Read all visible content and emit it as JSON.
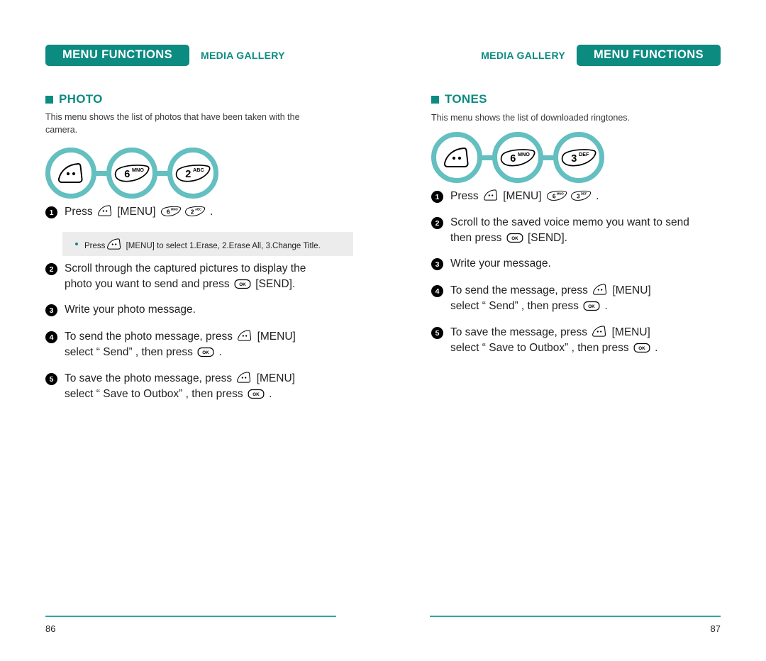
{
  "document": {
    "type": "mobile-phone-user-manual-spread"
  },
  "colors": {
    "teal_dark": "#0c8b81",
    "teal_light": "#63bfc0",
    "rule": "#2fa5ac",
    "note_bg": "#ececec",
    "text": "#231f20"
  },
  "left_page": {
    "header": {
      "tab_label": "MENU FUNCTIONS",
      "breadcrumb": "MEDIA GALLERY"
    },
    "section": {
      "title": "PHOTO",
      "intro": "This menu shows the list of photos that have been taken with the camera."
    },
    "keychain": [
      {
        "icon": "menu-key-icon",
        "label": "",
        "sub": ""
      },
      {
        "icon": "digit-key-icon",
        "label": "6",
        "sub": "MNO"
      },
      {
        "icon": "digit-key-icon",
        "label": "2",
        "sub": "ABC"
      }
    ],
    "steps": [
      {
        "num": "1",
        "lines": [
          [
            {
              "t": "text",
              "v": "Press "
            },
            {
              "t": "key-menu"
            },
            {
              "t": "text",
              "v": " [MENU] "
            },
            {
              "t": "key-digit",
              "v": "6",
              "sub": "MNO"
            },
            {
              "t": "key-digit",
              "v": "2",
              "sub": "ABC"
            },
            {
              "t": "text",
              "v": " ."
            }
          ]
        ]
      },
      {
        "num": "2",
        "lines": [
          [
            {
              "t": "text",
              "v": "Scroll through the captured pictures to display the"
            }
          ],
          [
            {
              "t": "text",
              "v": "photo you want to send and press "
            },
            {
              "t": "key-ok"
            },
            {
              "t": "text",
              "v": " [SEND]."
            }
          ]
        ]
      },
      {
        "num": "3",
        "lines": [
          [
            {
              "t": "text",
              "v": "Write your photo message."
            }
          ]
        ]
      },
      {
        "num": "4",
        "lines": [
          [
            {
              "t": "text",
              "v": "To send the photo message, press "
            },
            {
              "t": "key-menu"
            },
            {
              "t": "text",
              "v": " [MENU]"
            }
          ],
          [
            {
              "t": "text",
              "v": "select “ Send” , then press "
            },
            {
              "t": "key-ok"
            },
            {
              "t": "text",
              "v": " ."
            }
          ]
        ]
      },
      {
        "num": "5",
        "lines": [
          [
            {
              "t": "text",
              "v": "To save the photo message, press "
            },
            {
              "t": "key-menu"
            },
            {
              "t": "text",
              "v": " [MENU]"
            }
          ],
          [
            {
              "t": "text",
              "v": "select “ Save to Outbox” , then press "
            },
            {
              "t": "key-ok"
            },
            {
              "t": "text",
              "v": " ."
            }
          ]
        ]
      }
    ],
    "note": {
      "parts": [
        {
          "t": "text",
          "v": "Press"
        },
        {
          "t": "key-menu"
        },
        {
          "t": "text",
          "v": " [MENU] to select 1.Erase, 2.Erase All, 3.Change Title."
        }
      ]
    },
    "page_number": "86"
  },
  "right_page": {
    "header": {
      "tab_label": "MENU FUNCTIONS",
      "breadcrumb": "MEDIA GALLERY"
    },
    "section": {
      "title": "TONES",
      "intro": "This menu shows the list of downloaded ringtones."
    },
    "keychain": [
      {
        "icon": "menu-key-icon",
        "label": "",
        "sub": ""
      },
      {
        "icon": "digit-key-icon",
        "label": "6",
        "sub": "MNO"
      },
      {
        "icon": "digit-key-icon",
        "label": "3",
        "sub": "DEF"
      }
    ],
    "steps": [
      {
        "num": "1",
        "lines": [
          [
            {
              "t": "text",
              "v": "Press "
            },
            {
              "t": "key-menu"
            },
            {
              "t": "text",
              "v": " [MENU] "
            },
            {
              "t": "key-digit",
              "v": "6",
              "sub": "MNO"
            },
            {
              "t": "key-digit",
              "v": "3",
              "sub": "DEF"
            },
            {
              "t": "text",
              "v": " ."
            }
          ]
        ]
      },
      {
        "num": "2",
        "lines": [
          [
            {
              "t": "text",
              "v": "Scroll to the saved voice memo you want to send"
            }
          ],
          [
            {
              "t": "text",
              "v": "then press "
            },
            {
              "t": "key-ok"
            },
            {
              "t": "text",
              "v": " [SEND]."
            }
          ]
        ]
      },
      {
        "num": "3",
        "lines": [
          [
            {
              "t": "text",
              "v": "Write your message."
            }
          ]
        ]
      },
      {
        "num": "4",
        "lines": [
          [
            {
              "t": "text",
              "v": "To send the message, press "
            },
            {
              "t": "key-menu"
            },
            {
              "t": "text",
              "v": " [MENU]"
            }
          ],
          [
            {
              "t": "text",
              "v": "select “ Send” , then press "
            },
            {
              "t": "key-ok"
            },
            {
              "t": "text",
              "v": " ."
            }
          ]
        ]
      },
      {
        "num": "5",
        "lines": [
          [
            {
              "t": "text",
              "v": "To save the message, press "
            },
            {
              "t": "key-menu"
            },
            {
              "t": "text",
              "v": " [MENU]"
            }
          ],
          [
            {
              "t": "text",
              "v": "select “ Save to Outbox” , then press "
            },
            {
              "t": "key-ok"
            },
            {
              "t": "text",
              "v": " ."
            }
          ]
        ]
      }
    ],
    "page_number": "87"
  }
}
